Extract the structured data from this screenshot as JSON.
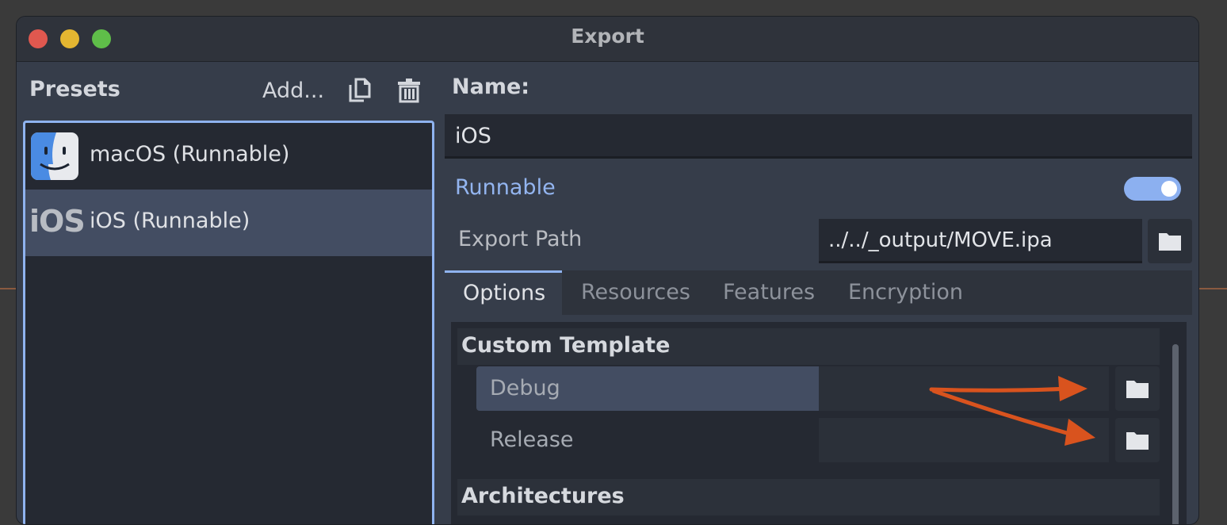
{
  "window": {
    "title": "Export"
  },
  "presets": {
    "header": "Presets",
    "add_label": "Add...",
    "items": [
      {
        "label": "macOS (Runnable)",
        "icon": "finder-icon",
        "selected": false
      },
      {
        "label": "iOS (Runnable)",
        "icon_text": "iOS",
        "selected": true
      }
    ]
  },
  "details": {
    "name_label": "Name:",
    "name_value": "iOS",
    "runnable_label": "Runnable",
    "runnable_on": true,
    "export_path_label": "Export Path",
    "export_path_value": "../../_output/MOVE.ipa"
  },
  "tabs": [
    {
      "label": "Options",
      "active": true
    },
    {
      "label": "Resources",
      "active": false
    },
    {
      "label": "Features",
      "active": false
    },
    {
      "label": "Encryption",
      "active": false
    }
  ],
  "options": {
    "custom_template": {
      "header": "Custom Template",
      "debug_label": "Debug",
      "debug_value": "",
      "release_label": "Release",
      "release_value": ""
    },
    "architectures_header": "Architectures"
  },
  "colors": {
    "accent": "#8fb3ef",
    "annotation_arrow": "#d9531e"
  }
}
